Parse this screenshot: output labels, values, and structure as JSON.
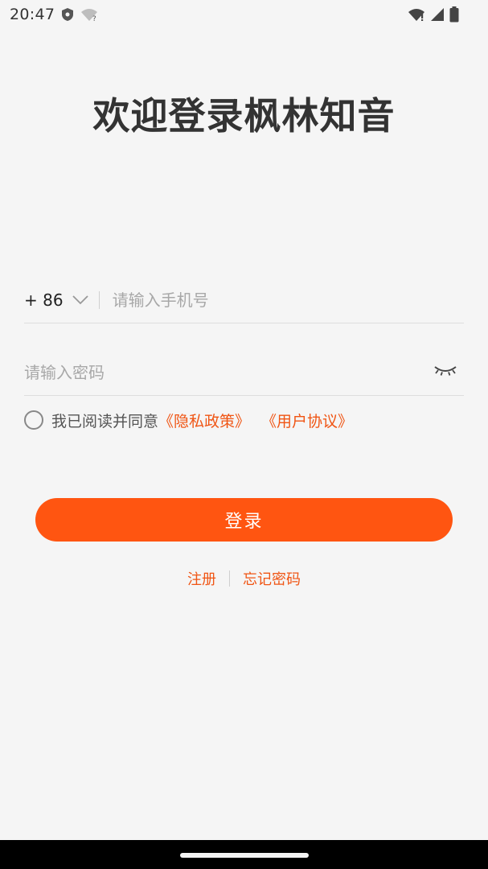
{
  "status_bar": {
    "time": "20:47",
    "icons": [
      "shield-icon",
      "wifi-question-icon",
      "wifi-alert-icon",
      "signal-icon",
      "battery-icon"
    ]
  },
  "title": "欢迎登录枫林知音",
  "phone": {
    "country_code": "+ 86",
    "placeholder": "请输入手机号"
  },
  "password": {
    "placeholder": "请输入密码"
  },
  "agreement": {
    "prefix": "我已阅读并同意",
    "privacy_link": "《隐私政策》",
    "terms_link": "《用户协议》"
  },
  "login_button": "登录",
  "links": {
    "register": "注册",
    "forgot_password": "忘记密码"
  },
  "colors": {
    "accent": "#ff5511",
    "link": "#f05514",
    "background": "#f5f5f5"
  }
}
